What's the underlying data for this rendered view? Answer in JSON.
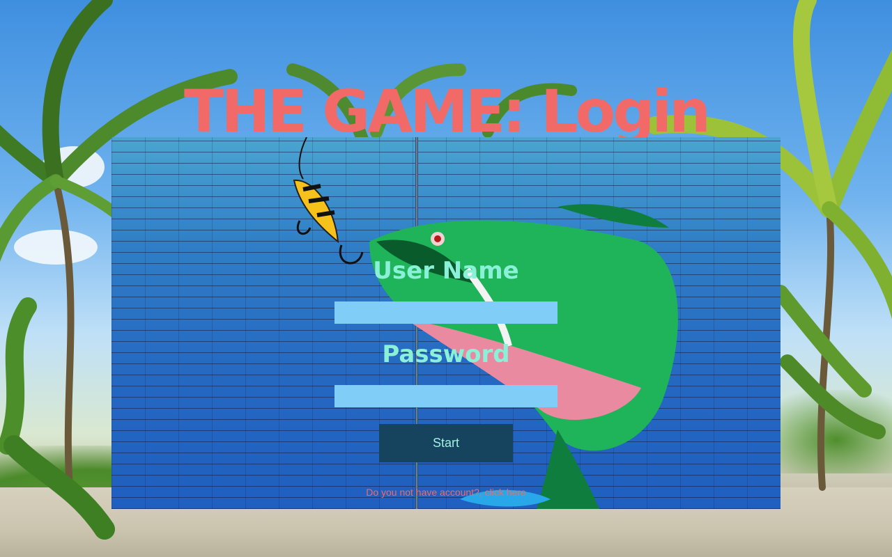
{
  "page": {
    "title": "THE GAME: Login"
  },
  "login_form": {
    "username_label": "User Name",
    "username_value": "",
    "password_label": "Password",
    "password_value": "",
    "start_label": "Start",
    "signup_link": "Do you not have account?, click here"
  },
  "colors": {
    "title": "#f26a67",
    "label": "#8af0d7",
    "input_bg": "#80cdf8",
    "button_bg": "#16445f",
    "button_text": "#a4f0e4",
    "link": "#f26a67"
  }
}
